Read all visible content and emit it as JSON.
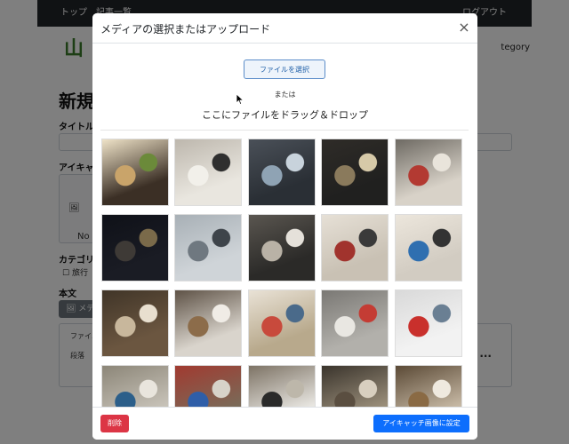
{
  "background": {
    "nav_left": "トップ　記事一覧",
    "nav_right": "ログアウト",
    "logo_text": "山",
    "category_link": "tegory",
    "page_title": "新規",
    "title_label": "タイトル",
    "eyecatch_label": "アイキャッ",
    "eyecatch_placeholder": "No",
    "category_label": "カテゴリー",
    "category_option": "旅行",
    "body_label": "本文",
    "media_button": "メデ",
    "editor_line1": "ファイル",
    "editor_line2": "段落",
    "editor_more": "..."
  },
  "modal": {
    "title": "メディアの選択またはアップロード",
    "close_icon": "×",
    "upload_button": "ファイルを選択",
    "or_text": "または",
    "drop_text": "ここにファイルをドラッグ＆ドロップ",
    "thumbnails": [
      {
        "name": "soba-bowl-photo"
      },
      {
        "name": "discount-coupon-photo"
      },
      {
        "name": "tea-cup-photo"
      },
      {
        "name": "soba-tray-photo"
      },
      {
        "name": "ticket-machine-photo"
      },
      {
        "name": "night-city-view-photo"
      },
      {
        "name": "observation-deck-photo"
      },
      {
        "name": "wall-panel-photo"
      },
      {
        "name": "vending-corner-photo"
      },
      {
        "name": "vending-machine-photo"
      },
      {
        "name": "restaurant-counter-photo"
      },
      {
        "name": "hallway-door-photo"
      },
      {
        "name": "souvenir-shop-photo"
      },
      {
        "name": "station-hall-photo"
      },
      {
        "name": "highway-bus-photo"
      },
      {
        "name": "waiting-room-photo"
      },
      {
        "name": "drink-vending-photo"
      },
      {
        "name": "waiting-room-sign-photo"
      },
      {
        "name": "bus-terminal-photo"
      },
      {
        "name": "sculpture-photo"
      }
    ],
    "delete_button": "削除",
    "set_eyecatch_button": "アイキャッチ画像に設定"
  },
  "colors": {
    "primary": "#0d6efd",
    "danger": "#dc3545",
    "nav_bg": "#212529"
  }
}
